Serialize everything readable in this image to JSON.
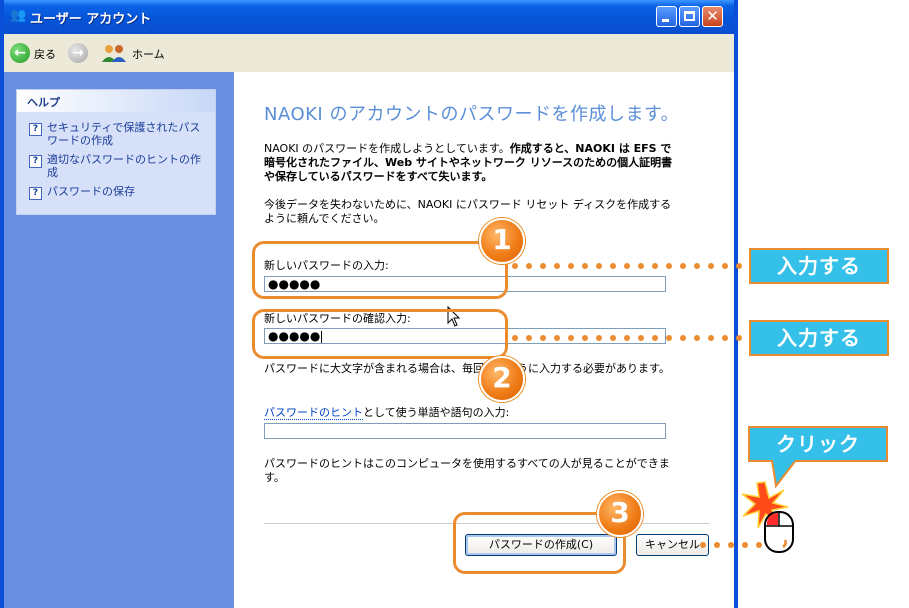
{
  "window": {
    "title": "ユーザー アカウント"
  },
  "nav": {
    "back_label": "戻る",
    "home_label": "ホーム"
  },
  "help": {
    "title": "ヘルプ",
    "items": [
      {
        "label": "セキュリティで保護されたパスワードの作成"
      },
      {
        "label": "適切なパスワードのヒントの作成"
      },
      {
        "label": "パスワードの保存"
      }
    ]
  },
  "main": {
    "heading": "NAOKI のアカウントのパスワードを作成します。",
    "intro_normal": "NAOKI のパスワードを作成しようとしています。",
    "intro_bold": "作成すると、NAOKI は EFS で暗号化されたファイル、Web サイトやネットワーク リソースのための個人証明書や保存しているパスワードをすべて失います。",
    "reset_note": "今後データを失わないために、NAOKI にパスワード リセット ディスクを作成するように頼んでください。",
    "new_password_label": "新しいパスワードの入力:",
    "new_password_value": "●●●●●",
    "confirm_password_label": "新しいパスワードの確認入力:",
    "confirm_password_value": "●●●●●",
    "case_note": "パスワードに大文字が含まれる場合は、毎回同じように入力する必要があります。",
    "hint_link": "パスワードのヒント",
    "hint_label_rest": "として使う単語や語句の入力:",
    "hint_value": "",
    "hint_note": "パスワードのヒントはこのコンピュータを使用するすべての人が見ることができます。",
    "create_button": "パスワードの作成(C)",
    "cancel_button": "キャンセル"
  },
  "annotations": {
    "step1": "1",
    "step2": "2",
    "step3": "3",
    "callout_input_1": "入力する",
    "callout_input_2": "入力する",
    "callout_click": "クリック",
    "accent_color": "#ec8c30",
    "callout_color": "#35c0ea"
  }
}
